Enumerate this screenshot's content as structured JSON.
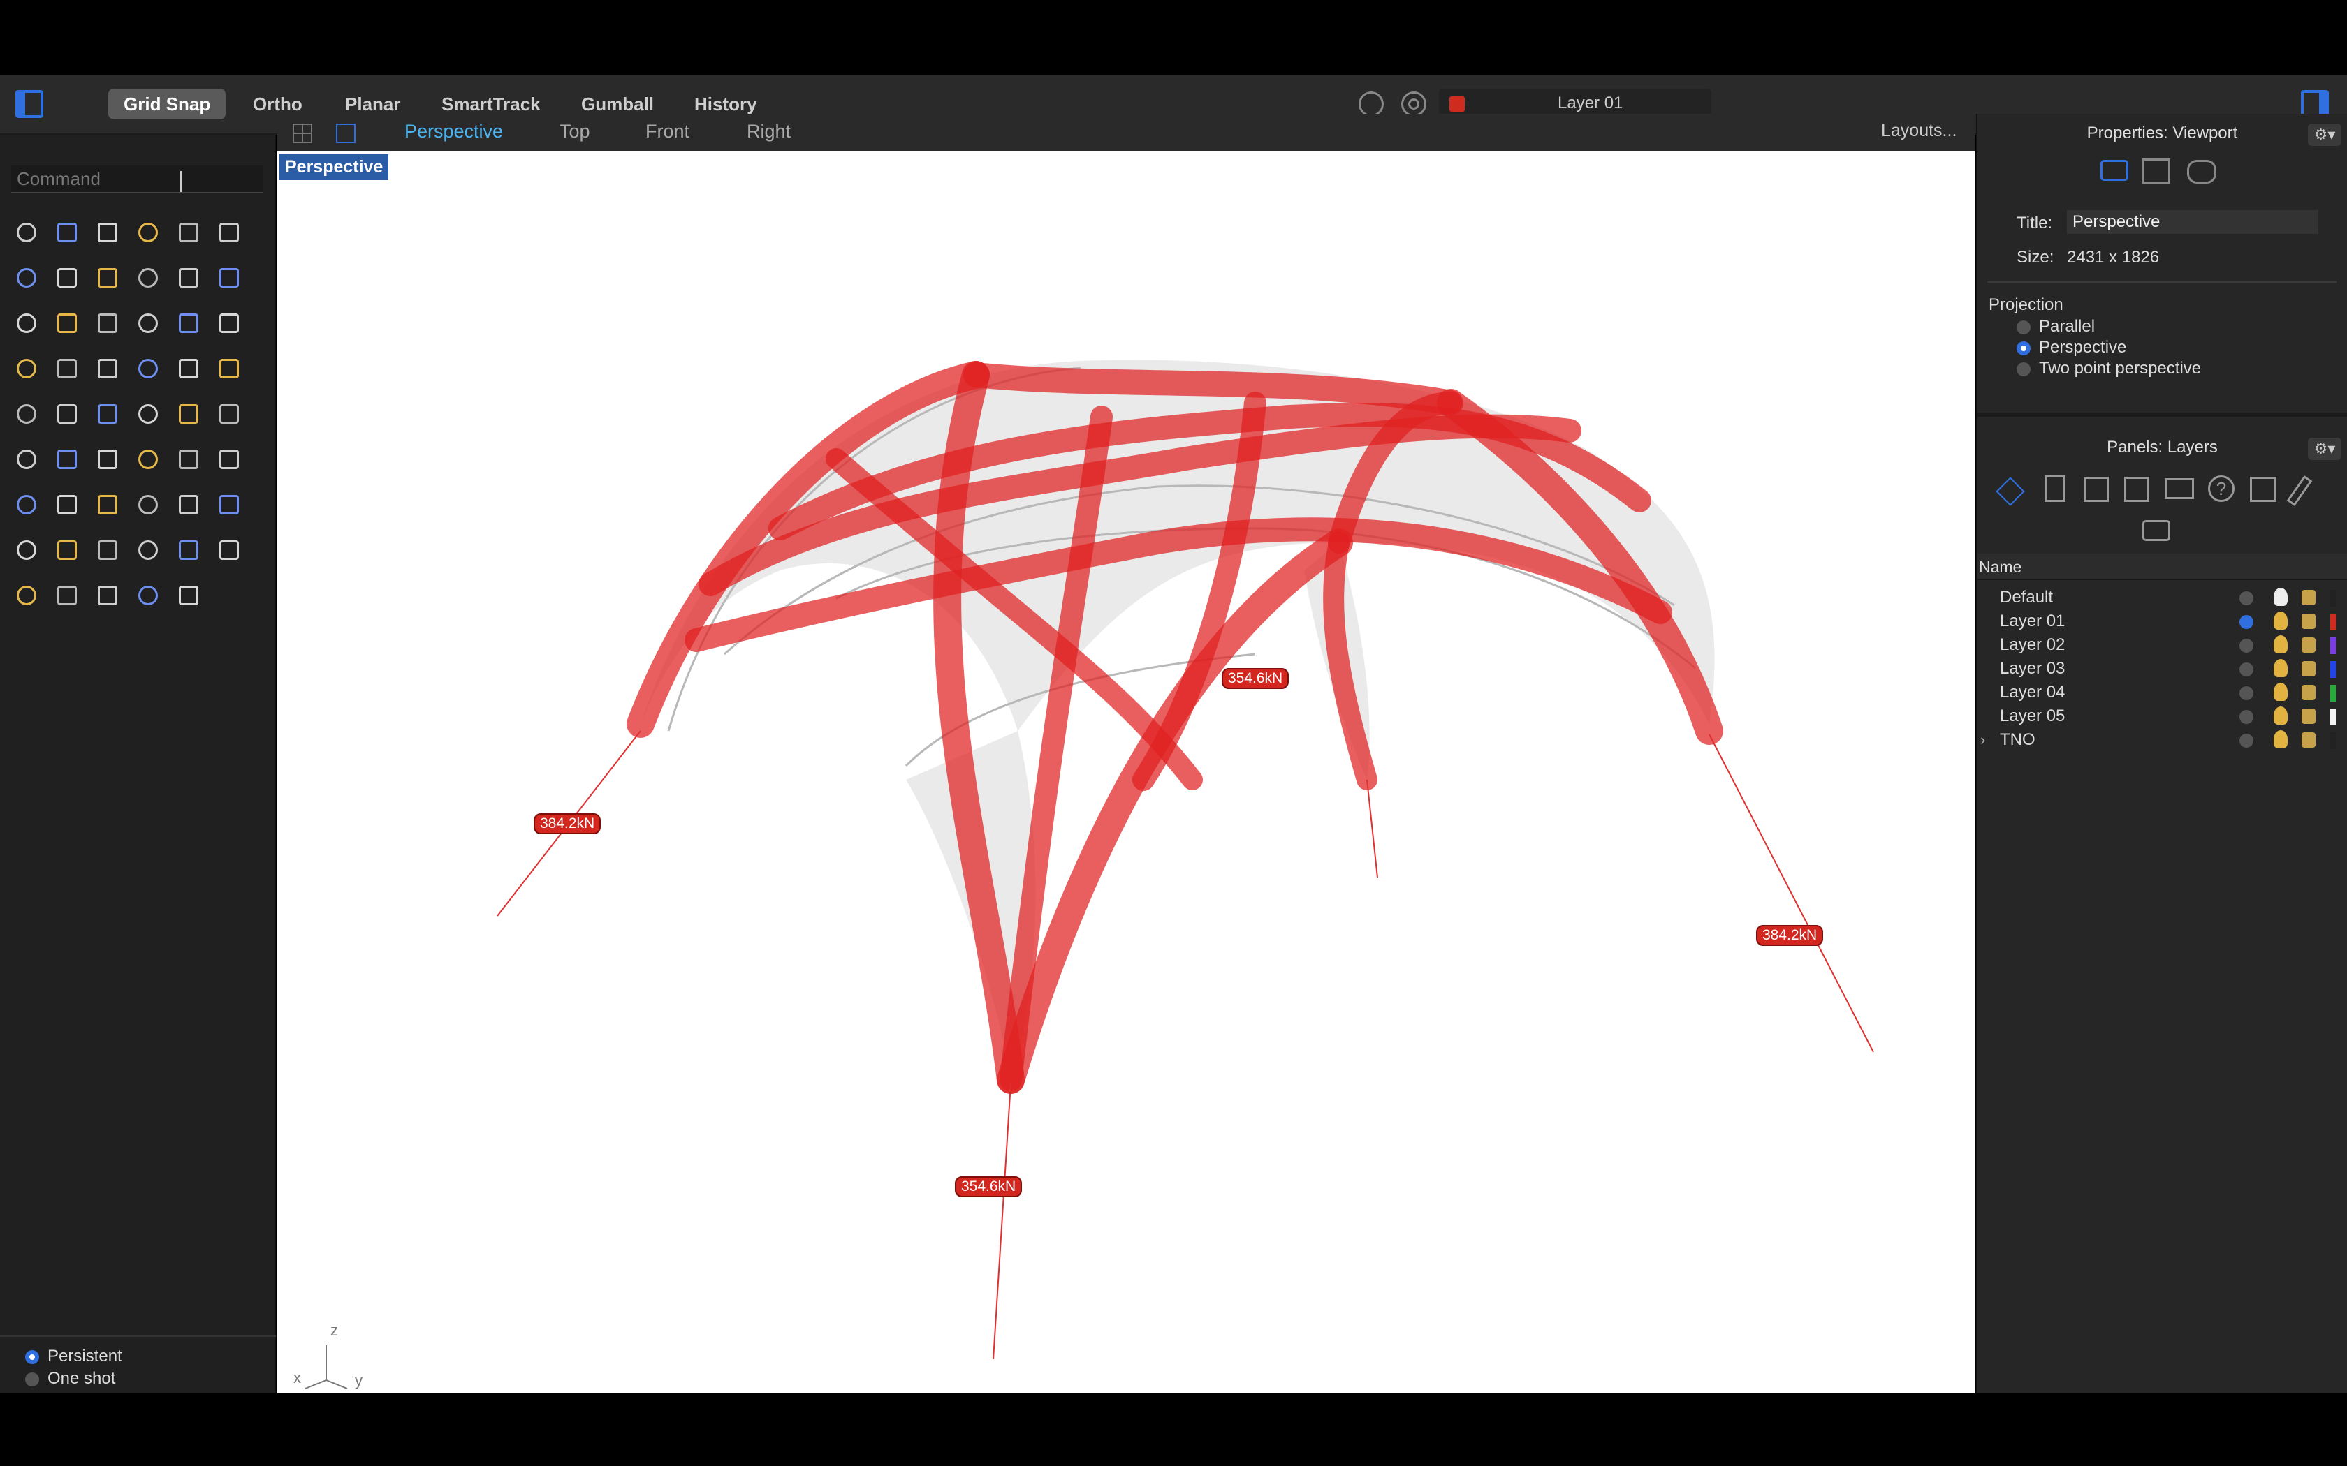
{
  "toolbar": {
    "buttons": [
      "Grid Snap",
      "Ortho",
      "Planar",
      "SmartTrack",
      "Gumball",
      "History"
    ],
    "layer_name": "Layer 01",
    "layer_color": "#d02b1f"
  },
  "command": {
    "placeholder": "Command"
  },
  "tabs": {
    "perspective": "Perspective",
    "top": "Top",
    "front": "Front",
    "right": "Right",
    "layouts": "Layouts..."
  },
  "viewport": {
    "label": "Perspective",
    "axis_z": "z",
    "axis_x": "x",
    "axis_y": "y"
  },
  "forces": {
    "f1": "384.2kN",
    "f2": "354.6kN",
    "f3": "384.2kN",
    "f4": "354.6kN"
  },
  "mode": {
    "persistent": "Persistent",
    "oneshot": "One shot"
  },
  "properties": {
    "title": "Properties: Viewport",
    "title_label": "Title:",
    "title_value": "Perspective",
    "size_label": "Size:",
    "size_value": "2431 x 1826",
    "projection": "Projection",
    "opt_parallel": "Parallel",
    "opt_perspective": "Perspective",
    "opt_twopoint": "Two point perspective"
  },
  "layers": {
    "title": "Panels: Layers",
    "column_name": "Name",
    "items": [
      {
        "name": "Default",
        "color": "#222222"
      },
      {
        "name": "Layer 01",
        "color": "#d02b1f"
      },
      {
        "name": "Layer 02",
        "color": "#7a3de0"
      },
      {
        "name": "Layer 03",
        "color": "#2345e8"
      },
      {
        "name": "Layer 04",
        "color": "#29a93a"
      },
      {
        "name": "Layer 05",
        "color": "#f2f2f2"
      },
      {
        "name": "TNO",
        "color": "#222222"
      }
    ]
  },
  "icons": {
    "accent": "#2f6fe0",
    "tools": [
      "select-arrow-icon",
      "point-icon",
      "polyline-icon",
      "curve-icon",
      "circle-icon",
      "ellipse-icon",
      "arc-icon",
      "rectangle-icon",
      "polygon-icon",
      "fillet-icon",
      "surface-icon",
      "extrude-icon",
      "box-icon",
      "sphere-icon",
      "cylinder-icon",
      "plane-icon",
      "explode-icon",
      "arrow-tool-icon",
      "trim-icon",
      "split-icon",
      "boolean-union-icon",
      "boolean-diff-icon",
      "rotate-icon",
      "sweep-icon",
      "text-icon",
      "scale-icon",
      "array-icon",
      "mirror-icon",
      "solid-edit-icon",
      "dimension-icon",
      "grid-icon",
      "bar-icon",
      "wall-icon",
      "check-icon",
      "shade-icon",
      "paint-icon",
      "zoom-icon",
      "zoom-window-icon",
      "zoom-extents-icon",
      "zoom-selected-icon",
      "undo-view-icon",
      "car-icon",
      "layer-plane-icon",
      "sun-icon",
      "light-icon",
      "lock-icon",
      "material-icon",
      "color-wheel-icon",
      "render-sphere-icon",
      "shaded-sphere-icon",
      "blue-sphere-icon",
      "pencil-icon",
      "gumball-icon"
    ]
  }
}
